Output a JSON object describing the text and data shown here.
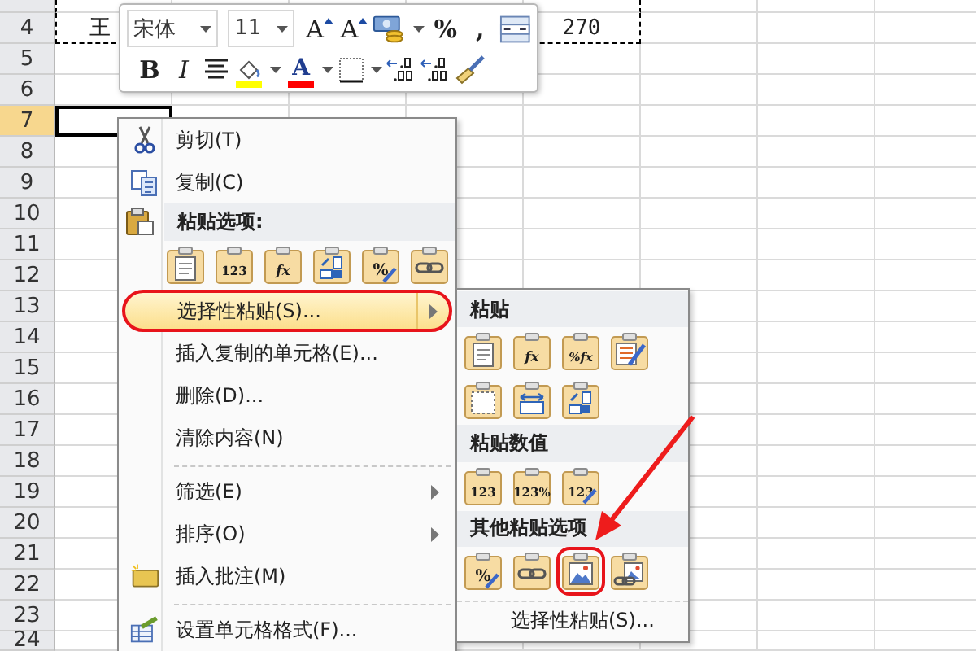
{
  "sheet": {
    "rows": [
      {
        "copied": true,
        "selected": false
      },
      {
        "number": "4",
        "copied": true,
        "selected": false,
        "cells": [
          "王",
          null,
          null,
          null,
          "270"
        ]
      },
      {
        "number": "5",
        "copied": false,
        "selected": false
      },
      {
        "number": "6",
        "copied": false,
        "selected": false
      },
      {
        "number": "7",
        "copied": false,
        "selected": true
      },
      {
        "number": "8",
        "copied": false,
        "selected": false
      },
      {
        "number": "9",
        "copied": false,
        "selected": false
      },
      {
        "number": "10",
        "copied": false,
        "selected": false
      },
      {
        "number": "11",
        "copied": false,
        "selected": false
      },
      {
        "number": "12",
        "copied": false,
        "selected": false
      },
      {
        "number": "13",
        "copied": false,
        "selected": false
      },
      {
        "number": "14",
        "copied": false,
        "selected": false
      },
      {
        "number": "15",
        "copied": false,
        "selected": false
      },
      {
        "number": "16",
        "copied": false,
        "selected": false
      },
      {
        "number": "17",
        "copied": false,
        "selected": false
      },
      {
        "number": "18",
        "copied": false,
        "selected": false
      },
      {
        "number": "19",
        "copied": false,
        "selected": false
      },
      {
        "number": "20",
        "copied": false,
        "selected": false
      },
      {
        "number": "21",
        "copied": false,
        "selected": false
      },
      {
        "number": "22",
        "copied": false,
        "selected": false
      },
      {
        "number": "23",
        "copied": false,
        "selected": false
      },
      {
        "number": "24",
        "copied": false,
        "selected": false
      }
    ]
  },
  "mini_toolbar": {
    "font": {
      "value": "宋体"
    },
    "size": {
      "value": "11"
    },
    "row_1": [
      {
        "kind": "grow-font",
        "glyph": "A"
      },
      {
        "kind": "shrink-font",
        "glyph": "A"
      },
      {
        "kind": "currency"
      },
      {
        "kind": "dropdown"
      },
      {
        "kind": "glyph",
        "glyph": "%"
      },
      {
        "kind": "glyph",
        "glyph": ","
      },
      {
        "kind": "merge"
      }
    ],
    "row_2": [
      {
        "kind": "bold",
        "glyph": "B"
      },
      {
        "kind": "italic",
        "glyph": "I"
      },
      {
        "kind": "center"
      },
      {
        "kind": "fill-color",
        "color": "#ffff00"
      },
      {
        "kind": "dropdown"
      },
      {
        "kind": "font-color",
        "glyph": "A",
        "color": "#ff0000"
      },
      {
        "kind": "dropdown"
      },
      {
        "kind": "borders"
      },
      {
        "kind": "dropdown"
      },
      {
        "kind": "increase-decimal"
      },
      {
        "kind": "decrease-decimal"
      },
      {
        "kind": "format-painter"
      }
    ]
  },
  "context_menu": {
    "items": [
      {
        "kind": "cut",
        "label": "剪切(T)",
        "selected": false,
        "has_submenu": false,
        "circled": false
      },
      {
        "kind": "copy",
        "label": "复制(C)",
        "selected": false,
        "has_submenu": false,
        "circled": false
      },
      {
        "kind": "paste-header",
        "label": "粘贴选项:"
      },
      {
        "kind": "paste-options",
        "options": [
          {
            "kind": "document"
          },
          {
            "kind": "text",
            "glyph": "123"
          },
          {
            "kind": "formula",
            "glyph": "fx"
          },
          {
            "kind": "transpose"
          },
          {
            "kind": "text-brush",
            "glyph": "%"
          },
          {
            "kind": "link"
          }
        ]
      },
      {
        "kind": "plain",
        "label": "选择性粘贴(S)...",
        "selected": true,
        "has_submenu": true,
        "circled": true
      },
      {
        "kind": "plain",
        "label": "插入复制的单元格(E)...",
        "selected": false,
        "has_submenu": false,
        "circled": false
      },
      {
        "kind": "plain",
        "label": "删除(D)...",
        "selected": false,
        "has_submenu": false,
        "circled": false
      },
      {
        "kind": "plain",
        "label": "清除内容(N)",
        "selected": false,
        "has_submenu": false,
        "circled": false
      },
      {
        "kind": "separator"
      },
      {
        "kind": "plain",
        "label": "筛选(E)",
        "selected": false,
        "has_submenu": true,
        "circled": false
      },
      {
        "kind": "plain",
        "label": "排序(O)",
        "selected": false,
        "has_submenu": true,
        "circled": false
      },
      {
        "kind": "comment",
        "label": "插入批注(M)",
        "selected": false,
        "has_submenu": false,
        "circled": false
      },
      {
        "kind": "separator"
      },
      {
        "kind": "format-cells",
        "label": "设置单元格格式(F)...",
        "selected": false,
        "has_submenu": false,
        "circled": false
      }
    ]
  },
  "submenu": {
    "groups": [
      {
        "title": "粘贴",
        "options": [
          {
            "kind": "document",
            "circled": false
          },
          {
            "kind": "formula",
            "glyph": "fx",
            "circled": false
          },
          {
            "kind": "formula",
            "glyph": "%fx",
            "circled": false
          },
          {
            "kind": "format",
            "circled": false
          },
          {
            "kind": "borders",
            "circled": false
          },
          {
            "kind": "widths",
            "circled": false
          },
          {
            "kind": "transpose",
            "circled": false
          }
        ]
      },
      {
        "title": "粘贴数值",
        "options": [
          {
            "kind": "text",
            "glyph": "123",
            "circled": false
          },
          {
            "kind": "text",
            "glyph": "123%",
            "circled": false
          },
          {
            "kind": "text-brush",
            "glyph": "123",
            "circled": false
          }
        ]
      },
      {
        "title": "其他粘贴选项",
        "options": [
          {
            "kind": "text-brush",
            "glyph": "%",
            "circled": false
          },
          {
            "kind": "link",
            "circled": false
          },
          {
            "kind": "picture",
            "circled": true
          },
          {
            "kind": "linked-picture",
            "circled": false
          }
        ]
      }
    ],
    "footer": {
      "label": "选择性粘贴(S)...",
      "selected": false
    }
  }
}
